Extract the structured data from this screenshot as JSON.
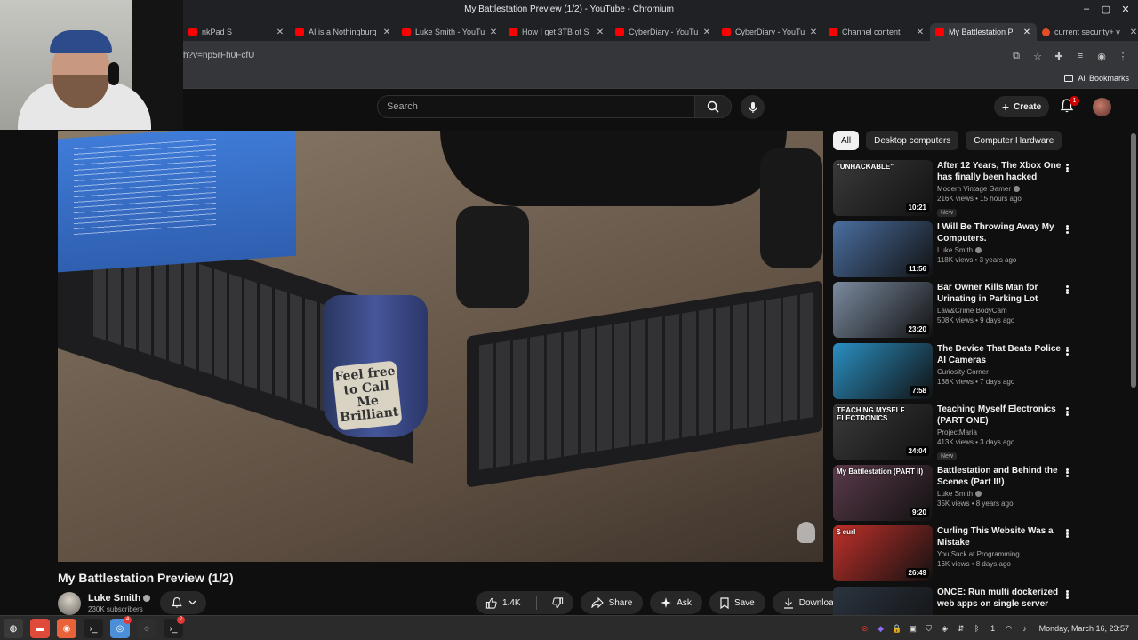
{
  "window": {
    "title": "My Battlestation Preview (1/2) - YouTube - Chromium"
  },
  "tabs": [
    {
      "label": "nkPad S",
      "favicon": "youtube-icon"
    },
    {
      "label": "AI is a Nothingburg",
      "favicon": "youtube-icon"
    },
    {
      "label": "Luke Smith - YouTu",
      "favicon": "youtube-icon"
    },
    {
      "label": "How I get 3TB of S",
      "favicon": "youtube-icon"
    },
    {
      "label": "CyberDiary - YouTu",
      "favicon": "youtube-icon"
    },
    {
      "label": "CyberDiary - YouTu",
      "favicon": "youtube-icon"
    },
    {
      "label": "Channel content",
      "favicon": "youtube-icon"
    },
    {
      "label": "My Battlestation P",
      "favicon": "youtube-icon",
      "active": true
    },
    {
      "label": "current security+ v",
      "favicon": "site-icon"
    }
  ],
  "address": {
    "url": "h?v=np5rFh0FcfU"
  },
  "bookmarks": {
    "all_label": "All Bookmarks"
  },
  "yt_header": {
    "search_placeholder": "Search",
    "create_label": "Create",
    "notification_count": "1"
  },
  "video": {
    "title": "My Battlestation Preview (1/2)",
    "channel": "Luke Smith",
    "subscribers": "230K subscribers",
    "mug_text": "Feel free to Call Me Brilliant",
    "actions": {
      "like_count": "1.4K",
      "share_label": "Share",
      "ask_label": "Ask",
      "save_label": "Save",
      "download_label": "Download"
    }
  },
  "chips": [
    "All",
    "Desktop computers",
    "Computer Hardware"
  ],
  "recommendations": [
    {
      "title": "After 12 Years, The Xbox One has finally been hacked",
      "channel": "Modern Vintage Gamer",
      "verified": true,
      "views": "216K views",
      "age": "15 hours ago",
      "duration": "10:21",
      "badge": "New",
      "thumb_text": "\"UNHACKABLE\"",
      "thumb_color": "#3a3a3a"
    },
    {
      "title": "I Will Be Throwing Away My Computers.",
      "channel": "Luke Smith",
      "verified": true,
      "views": "118K views",
      "age": "3 years ago",
      "duration": "11:56",
      "badge": "",
      "thumb_text": "",
      "thumb_color": "#4a6fa0"
    },
    {
      "title": "Bar Owner Kills Man for Urinating in Parking Lot",
      "channel": "Law&Crime BodyCam",
      "verified": false,
      "views": "508K views",
      "age": "9 days ago",
      "duration": "23:20",
      "badge": "",
      "thumb_text": "",
      "thumb_color": "#7b8ba0"
    },
    {
      "title": "The Device That Beats Police AI Cameras",
      "channel": "Curiosity Corner",
      "verified": false,
      "views": "138K views",
      "age": "7 days ago",
      "duration": "7:58",
      "badge": "",
      "thumb_text": "",
      "thumb_color": "#2a8fc2"
    },
    {
      "title": "Teaching Myself Electronics (PART ONE)",
      "channel": "ProjectMaria",
      "verified": false,
      "views": "413K views",
      "age": "3 days ago",
      "duration": "24:04",
      "badge": "New",
      "thumb_text": "TEACHING MYSELF ELECTRONICS",
      "thumb_color": "#3b3b3b"
    },
    {
      "title": "Battlestation and Behind the Scenes (Part II!)",
      "channel": "Luke Smith",
      "verified": true,
      "views": "35K views",
      "age": "8 years ago",
      "duration": "9:20",
      "badge": "",
      "thumb_text": "My Battlestation (PART II)",
      "thumb_color": "#5a3a4a"
    },
    {
      "title": "Curling This Website Was a Mistake",
      "channel": "You Suck at Programming",
      "verified": false,
      "views": "16K views",
      "age": "8 days ago",
      "duration": "26:49",
      "badge": "",
      "thumb_text": "$ curl",
      "thumb_color": "#c0302a"
    },
    {
      "title": "ONCE: Run multi dockerized web apps on single server",
      "channel": "",
      "verified": false,
      "views": "",
      "age": "",
      "duration": "",
      "badge": "",
      "thumb_text": "",
      "thumb_color": "#2b3440"
    }
  ],
  "taskbar": {
    "apps": [
      "mint-menu-icon",
      "files-icon",
      "firefox-icon",
      "terminal-icon",
      "chromium-icon",
      "obs-icon",
      "terminal-2-icon"
    ],
    "badges": {
      "chromium-icon": "4",
      "terminal-2-icon": "2"
    },
    "clock": "Monday, March 16, 23:57"
  },
  "colors": {
    "background": "#0f0f0f",
    "chip_active": "#f1f1f1",
    "yt_red": "#ff0000"
  }
}
